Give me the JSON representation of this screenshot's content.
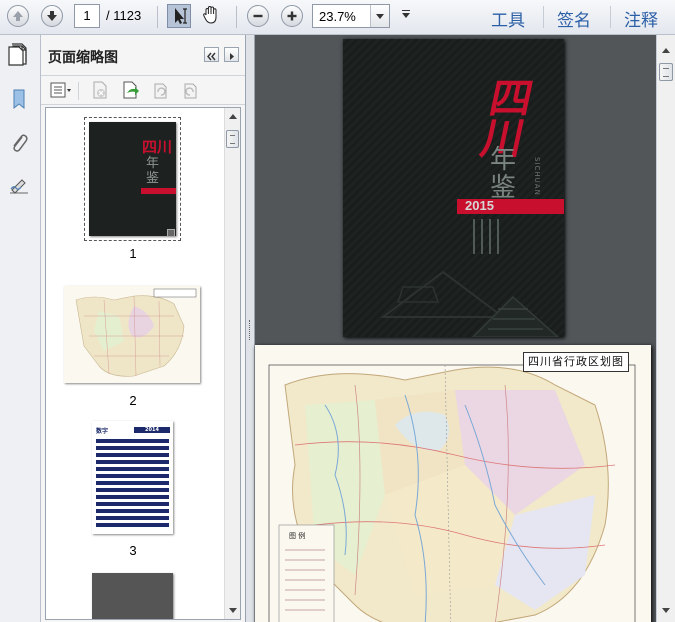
{
  "toolbar": {
    "page_current": "1",
    "page_total": "/ 1123",
    "zoom_value": "23.7%",
    "right_tabs": [
      "工具",
      "签名",
      "注释"
    ]
  },
  "thumbnail_panel": {
    "title": "页面缩略图",
    "thumbnails": [
      {
        "label": "1",
        "cover_title": "四川",
        "cover_sub": "年鉴",
        "cover_year": "2015"
      },
      {
        "label": "2",
        "map_title": "四川省行政区划图"
      },
      {
        "label": "3",
        "header_left": "数字",
        "header_right": "2014"
      },
      {
        "label": ""
      }
    ]
  },
  "document": {
    "page1": {
      "title": "四川",
      "subtitle": "年鉴",
      "year": "2015",
      "pinyin": "SICHUAN"
    },
    "page2": {
      "map_title": "四川省行政区划图",
      "legend_title": "图 例"
    }
  },
  "colors": {
    "accent": "#2b5fa6",
    "cover_red": "#c8102e",
    "cover_dark": "#1a1e1d",
    "doc_background": "#525659"
  }
}
